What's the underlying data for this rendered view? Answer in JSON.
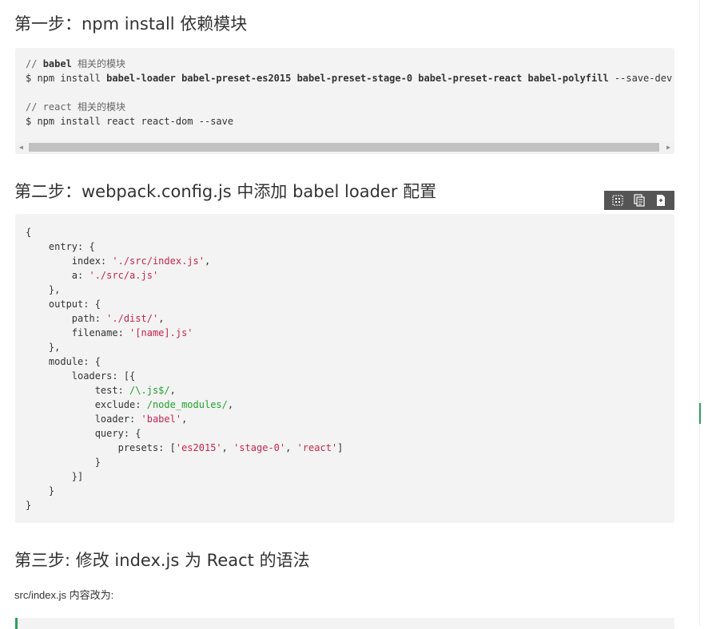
{
  "step1": {
    "title": "第一步：npm install 依赖模块",
    "code": {
      "comment1": "// ",
      "comment1_kw": "babel",
      "comment1_rest": " 相关的模块",
      "cmd1_prefix": "$ npm install ",
      "cmd1_pkgs": "babel-loader babel-preset-es2015 babel-preset-stage-0 babel-preset-react babel-polyfill",
      "cmd1_flag": " --save-dev",
      "comment2": "// react 相关的模块",
      "cmd2": "$ npm install react react-dom --save"
    }
  },
  "step2": {
    "title": "第二步：webpack.config.js 中添加 babel loader 配置",
    "toolbar": [
      "view-source-icon",
      "copy-icon",
      "print-icon"
    ],
    "code": {
      "open": "{",
      "entry": "    entry: {",
      "index_key": "        index: ",
      "index_val": "'./src/index.js'",
      "comma": ",",
      "a_key": "        a: ",
      "a_val": "'./src/a.js'",
      "close_comma_4": "    },",
      "output": "    output: {",
      "path_key": "        path: ",
      "path_val": "'./dist/'",
      "filename_key": "        filename: ",
      "filename_val": "'[name].js'",
      "module": "    module: {",
      "loaders": "        loaders: [{",
      "test_key": "            test: ",
      "test_val": "/\\.js$/",
      "exclude_key": "            exclude: ",
      "exclude_val": "/node_modules/",
      "loader_key": "            loader: ",
      "loader_val": "'babel'",
      "query": "            query: {",
      "presets_key": "                presets: [",
      "p1": "'es2015'",
      "sep": ", ",
      "p2": "'stage-0'",
      "p3": "'react'",
      "presets_end": "]",
      "close_12": "            }",
      "close_arr": "        }]",
      "close_4": "    }",
      "close": "}"
    }
  },
  "step3": {
    "title": "第三步: 修改 index.js 为 React 的语法",
    "paragraph": "src/index.js 内容改为:"
  },
  "colors": {
    "code_bg": "#f3f3f3",
    "string": "#c7254e",
    "regex": "#22a12a",
    "accent": "#2e9e5b",
    "toolbar_bg": "#555555"
  }
}
